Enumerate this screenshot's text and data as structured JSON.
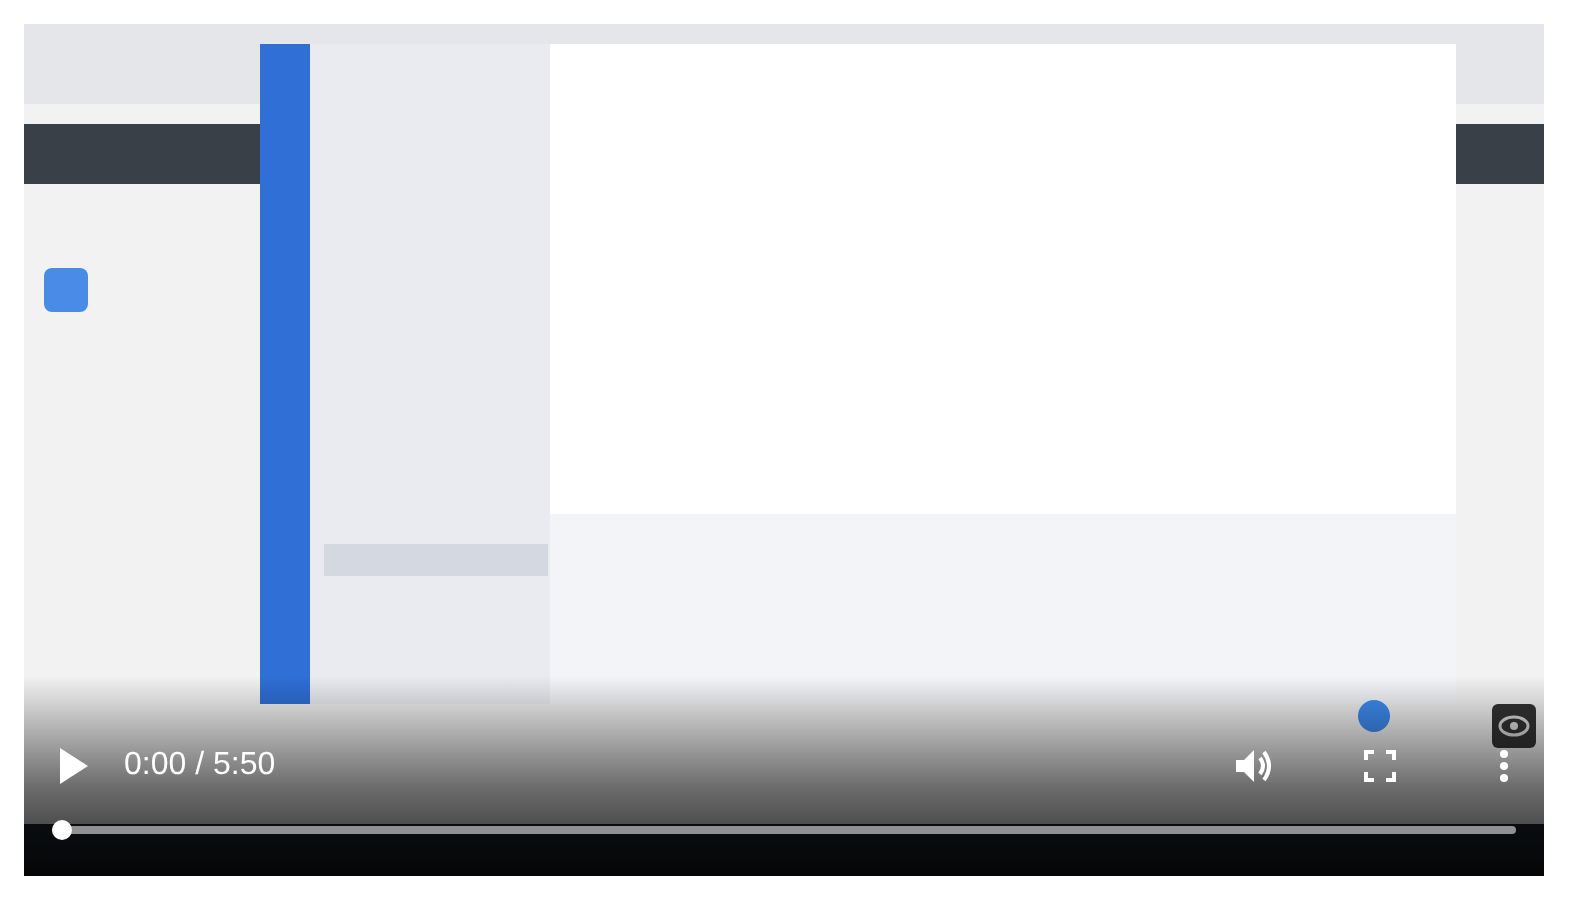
{
  "player": {
    "playing": false,
    "time": "0:00 / 5:50",
    "progress": {
      "level": 0
    }
  }
}
